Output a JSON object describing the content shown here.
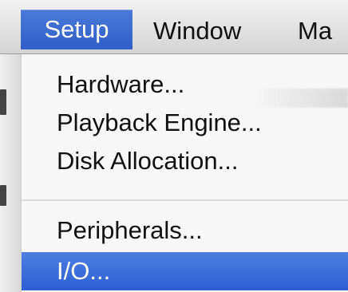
{
  "menubar": {
    "items": [
      {
        "label": "Setup",
        "active": true
      },
      {
        "label": "Window",
        "active": false
      },
      {
        "label": "Ma",
        "active": false
      }
    ]
  },
  "dropdown": {
    "items": [
      {
        "label": "Hardware...",
        "selected": false
      },
      {
        "label": "Playback Engine...",
        "selected": false
      },
      {
        "label": "Disk Allocation...",
        "selected": false
      },
      {
        "label": "Peripherals...",
        "selected": false
      },
      {
        "label": "I/O...",
        "selected": true
      }
    ]
  },
  "colors": {
    "selection": "#2f62d3",
    "menu_background": "#f7f7f7",
    "text": "#111111"
  }
}
